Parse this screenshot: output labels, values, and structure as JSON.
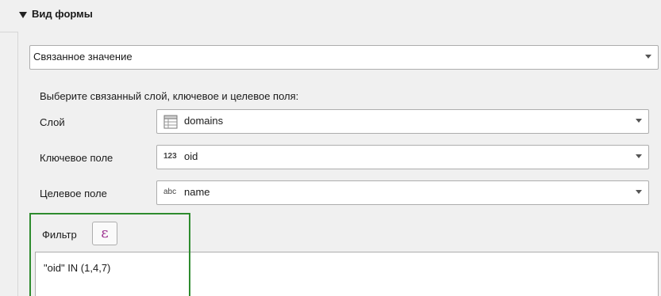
{
  "section": {
    "title": "Вид формы"
  },
  "widget_type": {
    "value": "Связанное значение"
  },
  "hint": "Выберите связанный слой, ключевое и целевое поля:",
  "fields": [
    {
      "label": "Слой",
      "value": "domains",
      "icon": "layer-table-icon"
    },
    {
      "label": "Ключевое поле",
      "value": "oid",
      "icon": "integer-field-icon",
      "icon_text": "123"
    },
    {
      "label": "Целевое поле",
      "value": "name",
      "icon": "string-field-icon",
      "icon_text": "abc"
    }
  ],
  "filter": {
    "label": "Фильтр",
    "button_symbol": "ε",
    "expression": "\"oid\" IN (1,4,7)"
  },
  "colors": {
    "highlight": "#2e8b2e",
    "expression_button": "#9b2d8e"
  }
}
